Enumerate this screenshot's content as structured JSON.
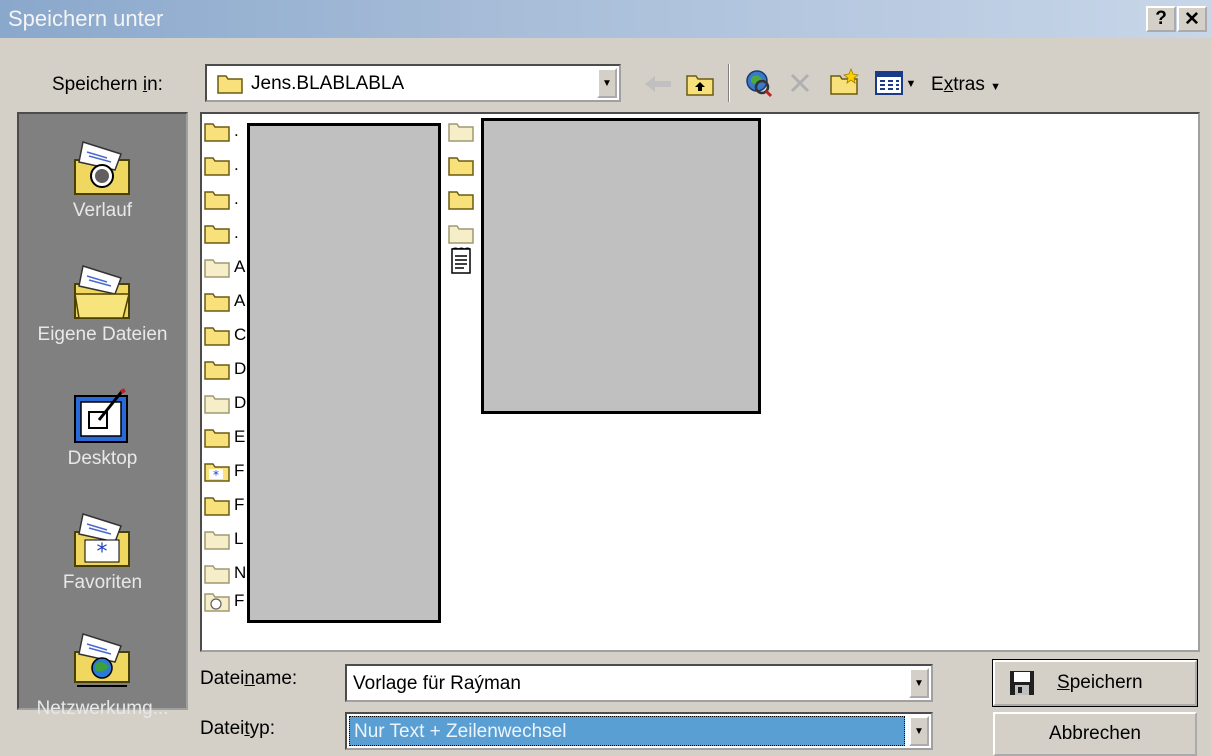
{
  "window": {
    "title": "Speichern unter",
    "help_label": "?",
    "close_label": "✕"
  },
  "location": {
    "label_pre": "Speichern ",
    "label_u": "i",
    "label_post": "n:",
    "value": "Jens.BLABLABLA"
  },
  "toolbar": {
    "extras_pre": "E",
    "extras_u": "x",
    "extras_post": "tras"
  },
  "places": [
    {
      "label": "Verlauf",
      "icon": "history-folder-icon"
    },
    {
      "label": "Eigene Dateien",
      "icon": "my-documents-folder-icon"
    },
    {
      "label": "Desktop",
      "icon": "desktop-icon"
    },
    {
      "label": "Favoriten",
      "icon": "favorites-folder-icon"
    },
    {
      "label": "Netzwerkumg...",
      "icon": "network-folder-icon"
    }
  ],
  "files_col1": [
    {
      "name": ".",
      "icon": "folder-icon"
    },
    {
      "name": ".",
      "icon": "folder-icon"
    },
    {
      "name": ".",
      "icon": "folder-icon"
    },
    {
      "name": ".",
      "icon": "folder-icon"
    },
    {
      "name": "A",
      "icon": "folder-light-icon"
    },
    {
      "name": "A",
      "icon": "folder-icon"
    },
    {
      "name": "C",
      "icon": "folder-icon"
    },
    {
      "name": "D",
      "icon": "folder-icon"
    },
    {
      "name": "D",
      "icon": "folder-light-icon"
    },
    {
      "name": "E",
      "icon": "folder-icon"
    },
    {
      "name": "F",
      "icon": "favorites-folder-icon"
    },
    {
      "name": "F",
      "icon": "folder-icon"
    },
    {
      "name": "L",
      "icon": "folder-light-icon"
    },
    {
      "name": "N",
      "icon": "folder-light-icon"
    },
    {
      "name": "F",
      "icon": "history-folder-icon"
    }
  ],
  "files_col2": [
    {
      "name": "",
      "icon": "folder-light-icon"
    },
    {
      "name": "",
      "icon": "folder-icon"
    },
    {
      "name": "",
      "icon": "folder-icon"
    },
    {
      "name": "",
      "icon": "folder-light-icon"
    },
    {
      "name": "",
      "icon": "text-document-icon"
    }
  ],
  "filename": {
    "label_pre": "Datei",
    "label_u": "n",
    "label_post": "ame:",
    "value": "Vorlage für Raýman"
  },
  "filetype": {
    "label_pre": "Datei",
    "label_u": "t",
    "label_post": "yp:",
    "value": "Nur Text + Zeilenwechsel"
  },
  "buttons": {
    "save_u": "S",
    "save_rest": "peichern",
    "cancel": "Abbrechen"
  },
  "colors": {
    "selection": "#5a9fd4",
    "places_bg": "#808080",
    "title_from": "#8aa8cc"
  }
}
